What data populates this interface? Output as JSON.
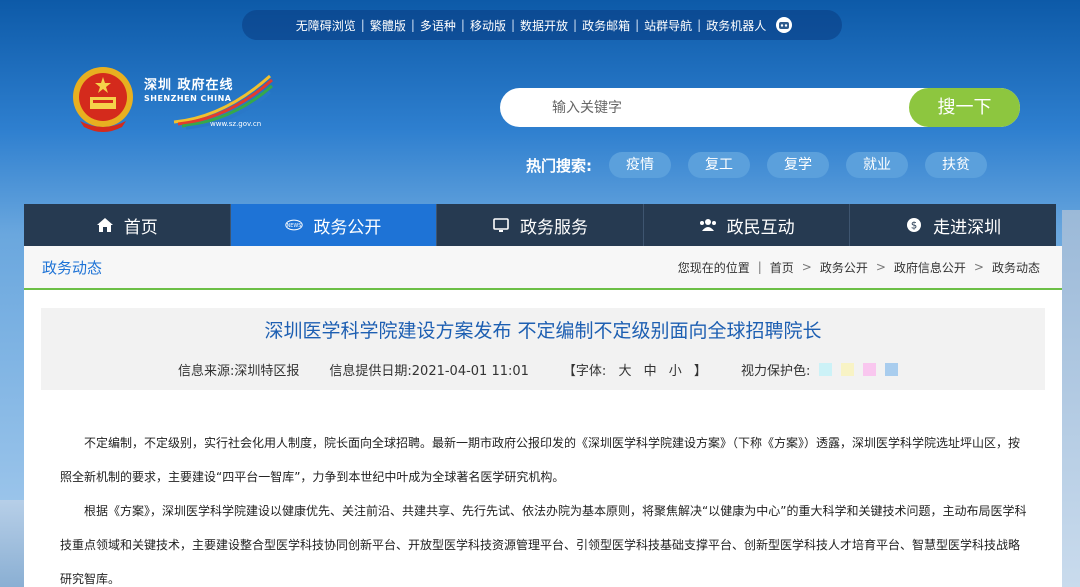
{
  "top_links": [
    "无障碍浏览",
    "繁體版",
    "多语种",
    "移动版",
    "数据开放",
    "政务邮箱",
    "站群导航",
    "政务机器人"
  ],
  "logo": {
    "text_cn": "深圳 政府在线",
    "text_en": "SHENZHEN CHINA",
    "url": "www.sz.gov.cn"
  },
  "search": {
    "placeholder": "输入关键字",
    "button": "搜一下"
  },
  "hot": {
    "label": "热门搜索:",
    "tags": [
      "疫情",
      "复工",
      "复学",
      "就业",
      "扶贫"
    ]
  },
  "nav": [
    {
      "label": "首页",
      "icon": "home-icon"
    },
    {
      "label": "政务公开",
      "icon": "news-icon"
    },
    {
      "label": "政务服务",
      "icon": "monitor-icon"
    },
    {
      "label": "政民互动",
      "icon": "users-icon"
    },
    {
      "label": "走进深圳",
      "icon": "compass-icon"
    }
  ],
  "section": "政务动态",
  "breadcrumb": {
    "label": "您现在的位置",
    "items": [
      "首页",
      "政务公开",
      "政府信息公开",
      "政务动态"
    ]
  },
  "article": {
    "title": "深圳医学科学院建设方案发布 不定编制不定级别面向全球招聘院长",
    "source": "信息来源:深圳特区报",
    "date": "信息提供日期:2021-04-01 11:01",
    "font_label_open": "【字体:",
    "font_sizes": [
      "大",
      "中",
      "小"
    ],
    "font_label_close": "】",
    "eye_label": "视力保护色:",
    "eye_colors": [
      "#ccf2f7",
      "#f8f3c5",
      "#f9c7ef",
      "#a9cdee"
    ],
    "paragraphs": [
      "不定编制，不定级别，实行社会化用人制度，院长面向全球招聘。最新一期市政府公报印发的《深圳医学科学院建设方案》（下称《方案》）透露，深圳医学科学院选址坪山区，按照全新机制的要求，主要建设“四平台一智库”，力争到本世纪中叶成为全球著名医学研究机构。",
      "根据《方案》，深圳医学科学院建设以健康优先、关注前沿、共建共享、先行先试、依法办院为基本原则，将聚焦解决“以健康为中心”的重大科学和关键技术问题，主动布局医学科技重点领域和关键技术，主要建设整合型医学科技协同创新平台、开放型医学科技资源管理平台、引领型医学科技基础支撑平台、创新型医学科技人才培育平台、智慧型医学科技战略研究智库。"
    ]
  },
  "colors": {
    "nav_bg": "#263a51",
    "nav_active": "#1e73d6",
    "search_button": "#8dc63f",
    "title": "#1d5fb2"
  }
}
